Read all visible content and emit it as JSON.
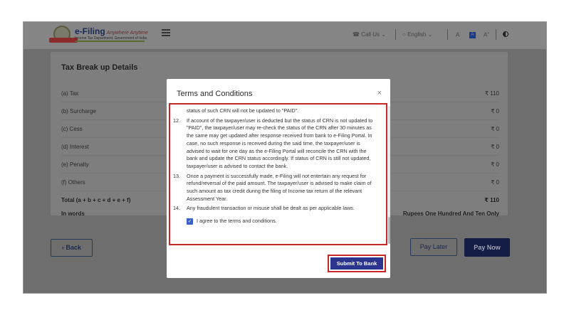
{
  "header": {
    "logo_title": "e-Filing",
    "logo_tagline": "Anywhere Anytime",
    "logo_subtitle": "Income Tax Department, Government of India",
    "call_us": "Call Us",
    "language": "English",
    "font_small": "A",
    "font_normal": "A",
    "font_large": "A",
    "font_small_sup": "-",
    "font_large_sup": "+"
  },
  "card": {
    "title": "Tax Break up Details",
    "rows": [
      {
        "label": "(a) Tax",
        "value": "₹ 110"
      },
      {
        "label": "(b) Surcharge",
        "value": "₹ 0"
      },
      {
        "label": "(c) Cess",
        "value": "₹ 0"
      },
      {
        "label": "(d) Interest",
        "value": "₹ 0"
      },
      {
        "label": "(e) Penalty",
        "value": "₹ 0"
      },
      {
        "label": "(f) Others",
        "value": "₹ 0"
      }
    ],
    "total_label": "Total (a + b + c + d + e + f)",
    "total_value": "₹ 110",
    "words_label": "In words",
    "words_value": "Rupees One Hundred And Ten Only"
  },
  "buttons": {
    "back": "Back",
    "pay_later": "Pay Later",
    "pay_now": "Pay Now"
  },
  "modal": {
    "title": "Terms and Conditions",
    "close": "×",
    "partial_text": "status of such CRN will not be updated to \"PAID\".",
    "terms": [
      {
        "num": "12.",
        "text": "If account of the taxpayer/user is deducted but the status of CRN is not updated to \"PAID\", the taxpayer/user may re-check the status of the CRN after 30 minutes as the same may get updated after response received from bank to e-Filing Portal. In case, no such response is received during the said time, the taxpayer/user is advised to wait for one day as the e-Filing Portal will reconcile the CRN with the bank and update the CRN status accordingly. If status of CRN is still not updated, taxpayer/user is advised to contact the bank."
      },
      {
        "num": "13.",
        "text": "Once a payment is successfully made, e-Filing will not entertain any request for refund/reversal of the paid amount. The taxpayer/user is advised to make claim of such amount as tax credit during the filing of Income tax return of the relevant Assessment Year."
      },
      {
        "num": "14.",
        "text": "Any fraudulent transaction or misuse shall be dealt as per applicable laws."
      }
    ],
    "agree_label": "I agree to the terms and conditions.",
    "agree_checked": true,
    "submit_label": "Submit To Bank"
  }
}
